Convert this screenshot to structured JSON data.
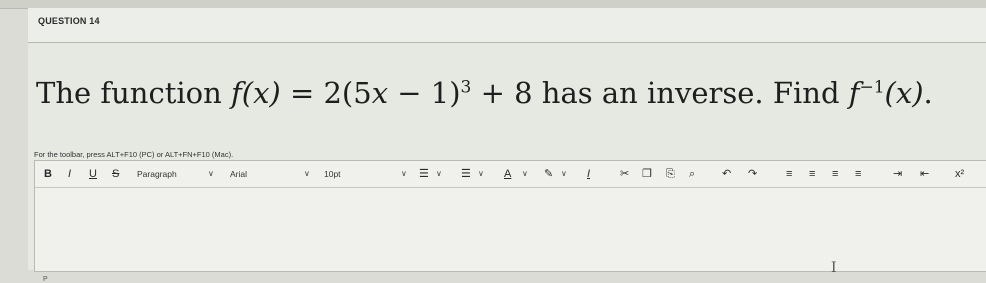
{
  "question": {
    "label": "QUESTION 14",
    "text_before": "The function ",
    "func": "f(x)",
    "equals": " = 2(5",
    "x1": "x",
    "minus": " − 1)",
    "exp": "3",
    "plus": " + 8 has an inverse. Find ",
    "finv": "f",
    "inv_exp": "−1",
    "finv_arg": "(x)",
    "period": "."
  },
  "editor": {
    "hint": "For the toolbar, press ALT+F10 (PC) or ALT+FN+F10 (Mac).",
    "toolbar": {
      "bold": "B",
      "italic": "I",
      "underline": "U",
      "strike": "S",
      "paragraph": "Paragraph",
      "font": "Arial",
      "size": "10pt",
      "chevron": "∨",
      "unordered_list": "☰",
      "ordered_list": "☰",
      "text_color": "A",
      "highlight": "✎",
      "clear_format": "I",
      "cut": "✂",
      "copy": "❐",
      "paste": "⎘",
      "find": "⌕",
      "undo": "↶",
      "redo": "↷",
      "align_left": "≡",
      "align_center": "≡",
      "align_right": "≡",
      "align_justify": "≡",
      "indent": "⇥",
      "outdent": "⇤",
      "superscript": "x²"
    },
    "status": "P"
  }
}
